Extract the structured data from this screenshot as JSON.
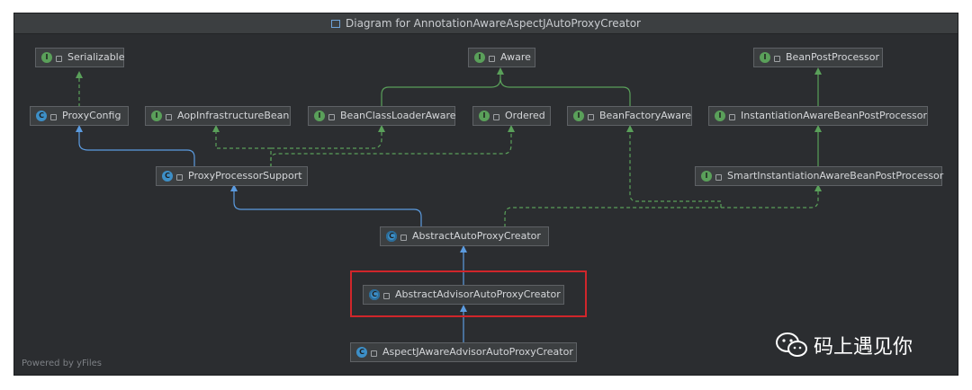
{
  "window": {
    "title": "Diagram for AnnotationAwareAspectJAutoProxyCreator",
    "footer": "Powered by yFiles"
  },
  "watermark": {
    "text": "码上遇见你",
    "icon": "wechat-icon"
  },
  "colors": {
    "background": "#2b2d30",
    "implements_edge": "#5aa05a",
    "extends_edge": "#5b9bdf",
    "highlight": "#d0262b"
  },
  "nodes": [
    {
      "id": "serializable",
      "label": "Serializable",
      "kind": "interface"
    },
    {
      "id": "aware",
      "label": "Aware",
      "kind": "interface"
    },
    {
      "id": "beanpostprocessor",
      "label": "BeanPostProcessor",
      "kind": "interface"
    },
    {
      "id": "proxyconfig",
      "label": "ProxyConfig",
      "kind": "class"
    },
    {
      "id": "aopinfrastructurebean",
      "label": "AopInfrastructureBean",
      "kind": "interface"
    },
    {
      "id": "beanclassloaderaware",
      "label": "BeanClassLoaderAware",
      "kind": "interface"
    },
    {
      "id": "ordered",
      "label": "Ordered",
      "kind": "interface"
    },
    {
      "id": "beanfactoryaware",
      "label": "BeanFactoryAware",
      "kind": "interface"
    },
    {
      "id": "instantiationawarebeanpostprocessor",
      "label": "InstantiationAwareBeanPostProcessor",
      "kind": "interface"
    },
    {
      "id": "proxyprocessorsupport",
      "label": "ProxyProcessorSupport",
      "kind": "class"
    },
    {
      "id": "smartinstantiationawarebeanpostprocessor",
      "label": "SmartInstantiationAwareBeanPostProcessor",
      "kind": "interface"
    },
    {
      "id": "abstractautoproxycreator",
      "label": "AbstractAutoProxyCreator",
      "kind": "abstract-class"
    },
    {
      "id": "abstractadvisorautoproxycreator",
      "label": "AbstractAdvisorAutoProxyCreator",
      "kind": "abstract-class"
    },
    {
      "id": "aspectjawareadvisorautoproxycreator",
      "label": "AspectJAwareAdvisorAutoProxyCreator",
      "kind": "class"
    }
  ],
  "edges": [
    {
      "from": "proxyconfig",
      "to": "serializable",
      "type": "implements"
    },
    {
      "from": "beanclassloaderaware",
      "to": "aware",
      "type": "extends-interface"
    },
    {
      "from": "beanfactoryaware",
      "to": "aware",
      "type": "extends-interface"
    },
    {
      "from": "instantiationawarebeanpostprocessor",
      "to": "beanpostprocessor",
      "type": "extends-interface"
    },
    {
      "from": "smartinstantiationawarebeanpostprocessor",
      "to": "instantiationawarebeanpostprocessor",
      "type": "extends-interface"
    },
    {
      "from": "proxyprocessorsupport",
      "to": "proxyconfig",
      "type": "extends"
    },
    {
      "from": "proxyprocessorsupport",
      "to": "aopinfrastructurebean",
      "type": "implements"
    },
    {
      "from": "proxyprocessorsupport",
      "to": "beanclassloaderaware",
      "type": "implements"
    },
    {
      "from": "proxyprocessorsupport",
      "to": "ordered",
      "type": "implements"
    },
    {
      "from": "abstractautoproxycreator",
      "to": "proxyprocessorsupport",
      "type": "extends"
    },
    {
      "from": "abstractautoproxycreator",
      "to": "smartinstantiationawarebeanpostprocessor",
      "type": "implements"
    },
    {
      "from": "abstractautoproxycreator",
      "to": "beanfactoryaware",
      "type": "implements"
    },
    {
      "from": "abstractadvisorautoproxycreator",
      "to": "abstractautoproxycreator",
      "type": "extends"
    },
    {
      "from": "aspectjawareadvisorautoproxycreator",
      "to": "abstractadvisorautoproxycreator",
      "type": "extends"
    }
  ],
  "highlighted_node": "abstractadvisorautoproxycreator"
}
